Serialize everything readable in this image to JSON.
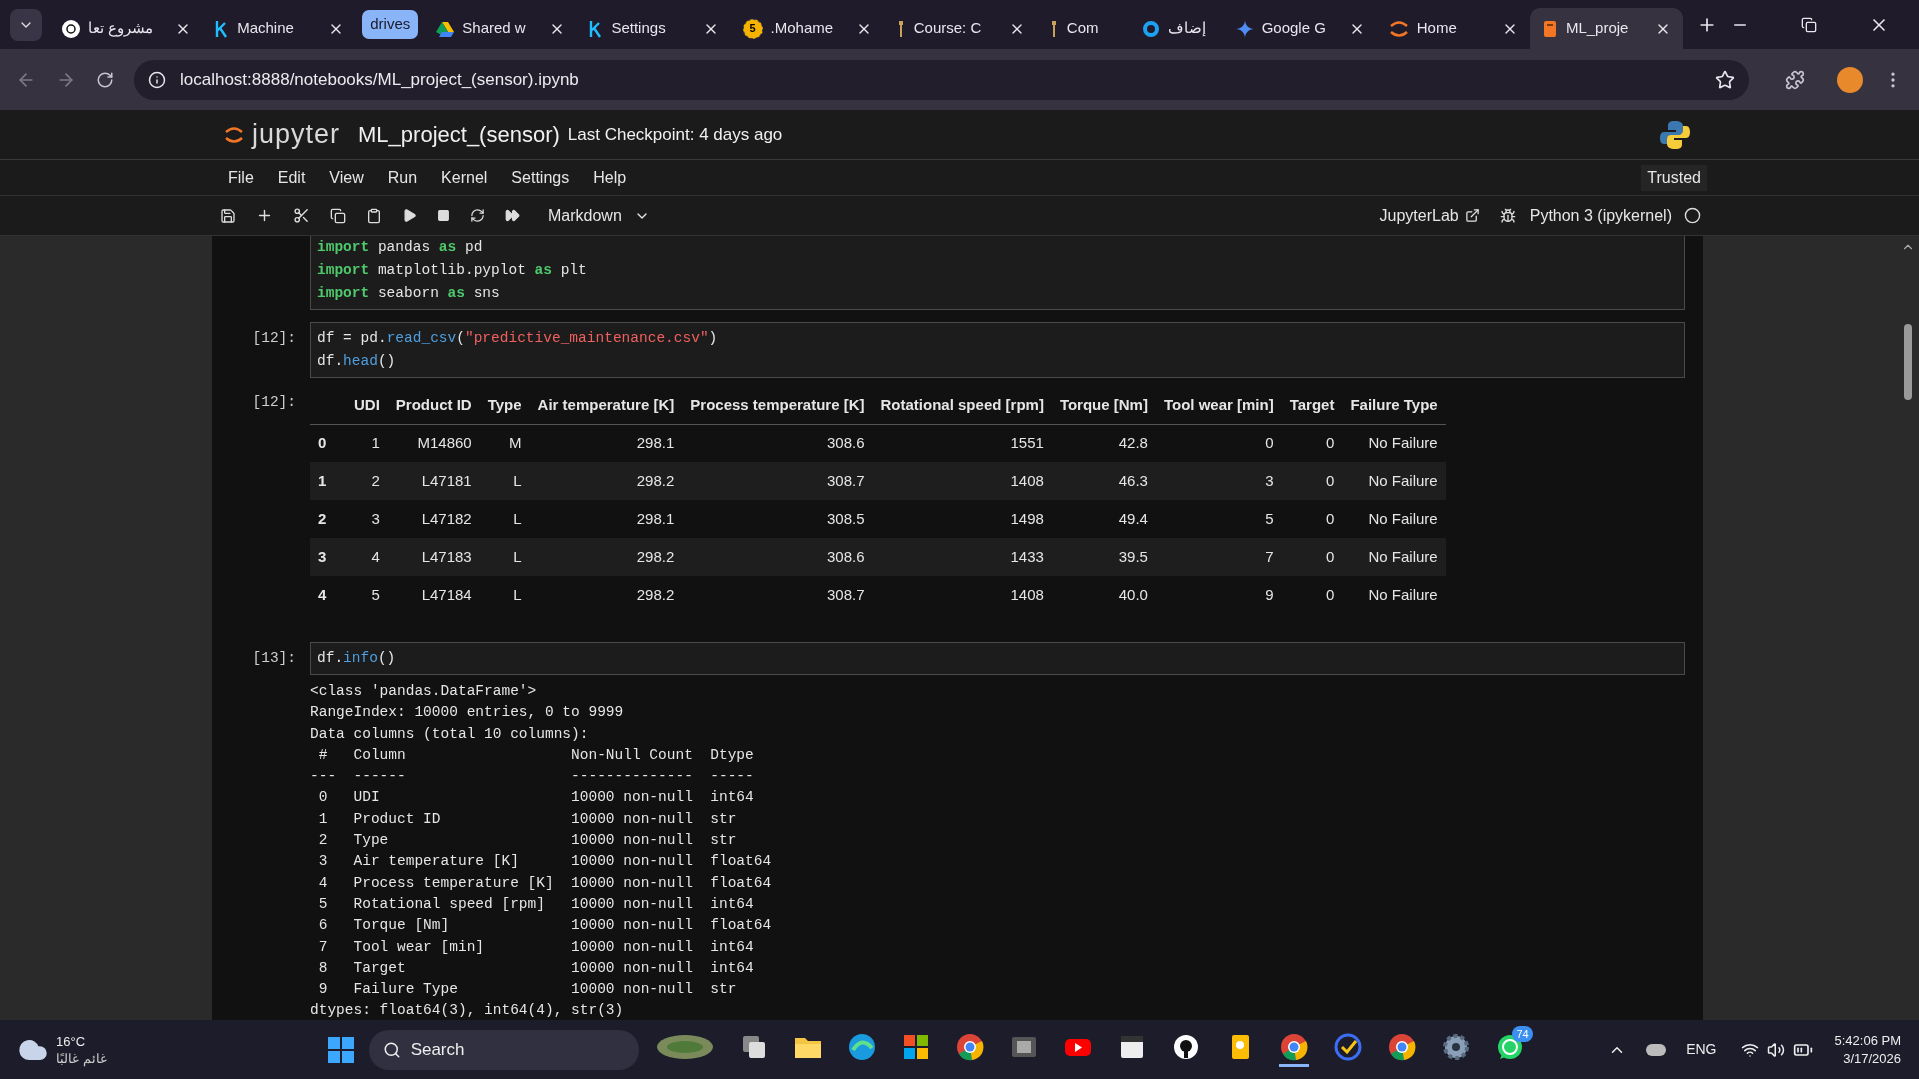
{
  "browser": {
    "tabs": [
      {
        "title": "مشروع تعا",
        "kind": "tab",
        "selected": false
      },
      {
        "title": "Machine",
        "kind": "tab",
        "selected": false
      },
      {
        "title": "drives",
        "kind": "group",
        "selected": false
      },
      {
        "title": "Shared w",
        "kind": "tab",
        "selected": false
      },
      {
        "title": "Settings",
        "kind": "tab",
        "selected": false
      },
      {
        "title": ".Mohame",
        "badge": "5",
        "kind": "tab",
        "selected": false
      },
      {
        "title": "Course: C",
        "kind": "tab",
        "selected": false
      },
      {
        "title": "Com",
        "kind": "pinned",
        "selected": false
      },
      {
        "title": "إضاف",
        "kind": "pinned",
        "selected": false
      },
      {
        "title": "Google G",
        "kind": "tab",
        "selected": false
      },
      {
        "title": "Home",
        "kind": "tab",
        "selected": false
      },
      {
        "title": "ML_proje",
        "kind": "tab",
        "selected": true
      }
    ],
    "url": "localhost:8888/notebooks/ML_project_(sensor).ipynb"
  },
  "jupyter": {
    "logo": "jupyter",
    "title": "ML_project_(sensor)",
    "checkpoint": "Last Checkpoint: 4 days ago",
    "trusted": "Trusted",
    "menu": [
      "File",
      "Edit",
      "View",
      "Run",
      "Kernel",
      "Settings",
      "Help"
    ],
    "cell_type": "Markdown",
    "lab_link": "JupyterLab",
    "kernel": "Python 3 (ipykernel)"
  },
  "cells": [
    {
      "source": [
        [
          {
            "text": "import",
            "kind": "keyword"
          },
          {
            "text": " pandas ",
            "kind": "plain"
          },
          {
            "text": "as",
            "kind": "keyword"
          },
          {
            "text": " pd",
            "kind": "plain"
          }
        ],
        [
          {
            "text": "import",
            "kind": "keyword"
          },
          {
            "text": " matplotlib.pyplot ",
            "kind": "plain"
          },
          {
            "text": "as",
            "kind": "keyword"
          },
          {
            "text": " plt",
            "kind": "plain"
          }
        ],
        [
          {
            "text": "import",
            "kind": "keyword"
          },
          {
            "text": " seaborn ",
            "kind": "plain"
          },
          {
            "text": "as",
            "kind": "keyword"
          },
          {
            "text": " sns",
            "kind": "plain"
          }
        ]
      ]
    },
    {
      "prompt": "[12]:",
      "source": [
        [
          {
            "text": "df = pd.",
            "kind": "plain"
          },
          {
            "text": "read_csv",
            "kind": "function"
          },
          {
            "text": "(",
            "kind": "plain"
          },
          {
            "text": "\"predictive_maintenance.csv\"",
            "kind": "string"
          },
          {
            "text": ")",
            "kind": "plain"
          }
        ],
        [
          {
            "text": "df.",
            "kind": "plain"
          },
          {
            "text": "head",
            "kind": "function"
          },
          {
            "text": "()",
            "kind": "plain"
          }
        ]
      ],
      "output": {
        "kind": "table",
        "prompt": "[12]:",
        "columns": [
          "UDI",
          "Product ID",
          "Type",
          "Air temperature [K]",
          "Process temperature [K]",
          "Rotational speed [rpm]",
          "Torque [Nm]",
          "Tool wear [min]",
          "Target",
          "Failure Type"
        ],
        "rows": [
          {
            "index": "0",
            "cells": [
              "1",
              "M14860",
              "M",
              "298.1",
              "308.6",
              "1551",
              "42.8",
              "0",
              "0",
              "No Failure"
            ]
          },
          {
            "index": "1",
            "cells": [
              "2",
              "L47181",
              "L",
              "298.2",
              "308.7",
              "1408",
              "46.3",
              "3",
              "0",
              "No Failure"
            ]
          },
          {
            "index": "2",
            "cells": [
              "3",
              "L47182",
              "L",
              "298.1",
              "308.5",
              "1498",
              "49.4",
              "5",
              "0",
              "No Failure"
            ]
          },
          {
            "index": "3",
            "cells": [
              "4",
              "L47183",
              "L",
              "298.2",
              "308.6",
              "1433",
              "39.5",
              "7",
              "0",
              "No Failure"
            ]
          },
          {
            "index": "4",
            "cells": [
              "5",
              "L47184",
              "L",
              "298.2",
              "308.7",
              "1408",
              "40.0",
              "9",
              "0",
              "No Failure"
            ]
          }
        ]
      }
    },
    {
      "prompt": "[13]:",
      "source": [
        [
          {
            "text": "df.",
            "kind": "plain"
          },
          {
            "text": "info",
            "kind": "function"
          },
          {
            "text": "()",
            "kind": "plain"
          }
        ]
      ],
      "output": {
        "kind": "text",
        "lines": [
          "<class 'pandas.DataFrame'>",
          "RangeIndex: 10000 entries, 0 to 9999",
          "Data columns (total 10 columns):",
          " #   Column                   Non-Null Count  Dtype  ",
          "---  ------                   --------------  -----  ",
          " 0   UDI                      10000 non-null  int64  ",
          " 1   Product ID               10000 non-null  str    ",
          " 2   Type                     10000 non-null  str    ",
          " 3   Air temperature [K]      10000 non-null  float64",
          " 4   Process temperature [K]  10000 non-null  float64",
          " 5   Rotational speed [rpm]   10000 non-null  int64  ",
          " 6   Torque [Nm]              10000 non-null  float64",
          " 7   Tool wear [min]          10000 non-null  int64  ",
          " 8   Target                   10000 non-null  int64  ",
          " 9   Failure Type             10000 non-null  str    ",
          "dtypes: float64(3), int64(4), str(3)"
        ]
      }
    }
  ],
  "taskbar": {
    "temperature": "16°C",
    "weather": "غائم غالبًا",
    "search": "Search",
    "apps": [
      {
        "active": false
      },
      {
        "active": false
      },
      {
        "active": false
      },
      {
        "active": false
      },
      {
        "active": false
      },
      {
        "active": false
      },
      {
        "active": false
      },
      {
        "active": false
      },
      {
        "active": false
      },
      {
        "active": false
      },
      {
        "active": false
      },
      {
        "active": true
      },
      {
        "active": false
      },
      {
        "active": false
      },
      {
        "active": false
      },
      {
        "active": false,
        "badge": "74"
      }
    ],
    "language": "ENG",
    "time": "5:42:06 PM",
    "date": "3/17/2026"
  }
}
